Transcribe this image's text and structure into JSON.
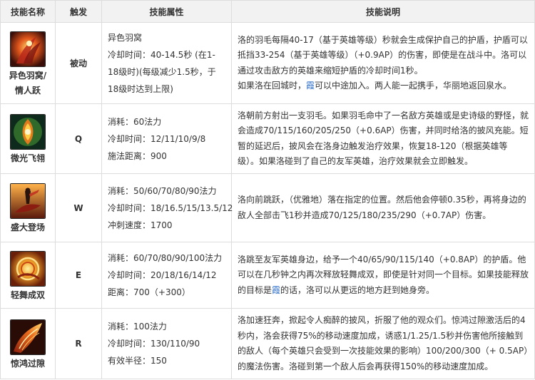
{
  "headers": {
    "name": "技能名称",
    "trigger": "触发",
    "attributes": "技能属性",
    "description": "技能说明"
  },
  "skills": [
    {
      "icon": "feather-nest-icon",
      "name_line1": "异色羽窝/",
      "name_line2": "情人跃",
      "trigger": "被动",
      "attributes": [
        "异色羽窝",
        "冷却时间：40-14.5秒 (在1-18级时)(每级减少1.5秒，于18级时达到上限)"
      ],
      "desc_p1": "洛的羽毛每隔40-17（基于英雄等级）秒就会生成保护自己的护盾，护盾可以抵挡33-254（基于英雄等级）（+0.9AP）的伤害，即使是在战斗中。洛可以通过攻击敌方的英雄来缩短护盾的冷却时间1秒。",
      "desc_p2_a": "如果洛在回城时，",
      "desc_p2_hl": "霞",
      "desc_p2_b": "可以中途加入。两人能一起携手，华丽地返回泉水。"
    },
    {
      "icon": "feather-eye-icon",
      "name_line1": "微光飞翎",
      "trigger": "Q",
      "attributes": [
        "消耗：60法力",
        "冷却时间：12/11/10/9/8",
        "施法距离：900"
      ],
      "desc": "洛朝前方射出一支羽毛。如果羽毛命中了一名敌方英雄或是史诗级的野怪，就会造成70/115/160/205/250（+0.6AP）伤害，并同时给洛的披风充能。短暂的延迟后，披风会在洛身边触发治疗效果，恢复18-120（根据英雄等级）。如果洛碰到了自己的友军英雄，治疗效果就会立即触发。"
    },
    {
      "icon": "dancer-leap-icon",
      "name_line1": "盛大登场",
      "trigger": "W",
      "attributes": [
        "消耗：50/60/70/80/90法力",
        "冷却时间：18/16.5/15/13.5/12",
        "冲刺速度：1700"
      ],
      "desc": "洛向前跳跃，（优雅地）落在指定的位置。然后他会停顿0.35秒，再将身边的敌人全部击飞1秒并造成70/125/180/235/290（+0.7AP）伤害。"
    },
    {
      "icon": "spin-dance-icon",
      "name_line1": "轻舞成双",
      "trigger": "E",
      "attributes": [
        "消耗：60/70/80/90/100法力",
        "冷却时间：20/18/16/14/12",
        "距离：700（+300）"
      ],
      "desc_a": "洛跳至友军英雄身边，给予一个40/65/90/115/140（+0.8AP）的护盾。他可以在几秒钟之内再次释放轻舞成双，即使是针对同一个目标。如果技能释放的目标是",
      "desc_hl": "霞",
      "desc_b": "的话，洛可以从更远的地方赶到她身旁。"
    },
    {
      "icon": "feather-storm-icon",
      "name_line1": "惊鸿过隙",
      "trigger": "R",
      "attributes": [
        "消耗：100法力",
        "冷却时间：130/110/90",
        "有效半径：150"
      ],
      "desc": "洛加速狂奔，掀起令人痴醉的披风，折服了他的观众们。惊鸿过隙激活后的4秒内，洛会获得75%的移动速度加成，诱惑1/1.25/1.5秒并伤害他所接触到的敌人（每个英雄只会受到一次技能效果的影响）100/200/300（+ 0.5AP）的魔法伤害。洛碰到第一个敌人后会再获得150%的移动速度加成。"
    }
  ]
}
